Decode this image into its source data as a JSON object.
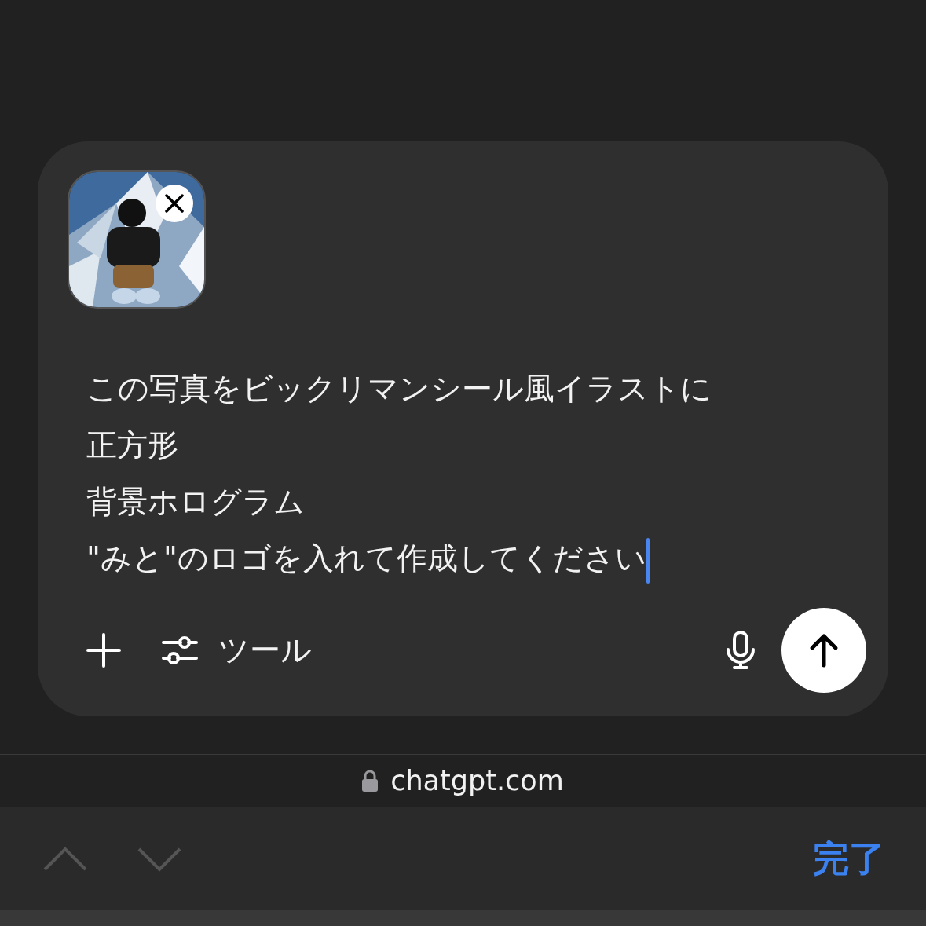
{
  "composer": {
    "attachment": {
      "kind": "picture",
      "removable": true
    },
    "prompt": {
      "lines": [
        "この写真をビックリマンシール風イラストに",
        "正方形",
        "背景ホログラム",
        "\"みと\"のロゴを入れて作成してください"
      ],
      "focused": true
    },
    "toolbar": {
      "tools_label": "ツール"
    }
  },
  "address_bar": {
    "url": "chatgpt.com",
    "secure": true
  },
  "keyboard_bar": {
    "previous": {
      "disabled": true
    },
    "next": {
      "disabled": true
    },
    "done": "完了"
  }
}
